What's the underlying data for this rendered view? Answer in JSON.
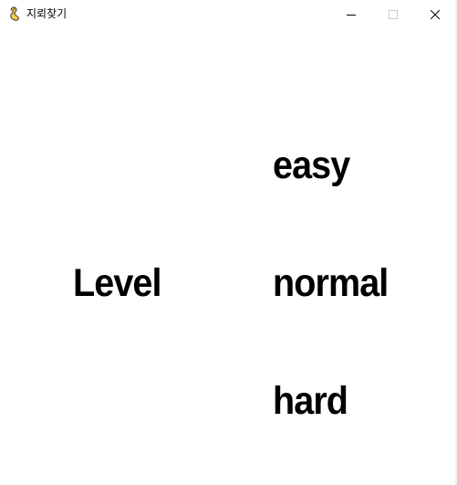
{
  "window": {
    "title": "지뢰찾기",
    "icon": "pygame-snake-icon"
  },
  "controls": {
    "minimize_icon": "minimize-icon",
    "maximize_icon": "maximize-icon",
    "close_icon": "close-icon"
  },
  "menu": {
    "heading": "Level",
    "options": [
      "easy",
      "normal",
      "hard"
    ]
  },
  "colors": {
    "background": "#ffffff",
    "text": "#000000",
    "app_icon_yellow": "#f2c94c",
    "app_icon_dark": "#3a3a3a"
  }
}
